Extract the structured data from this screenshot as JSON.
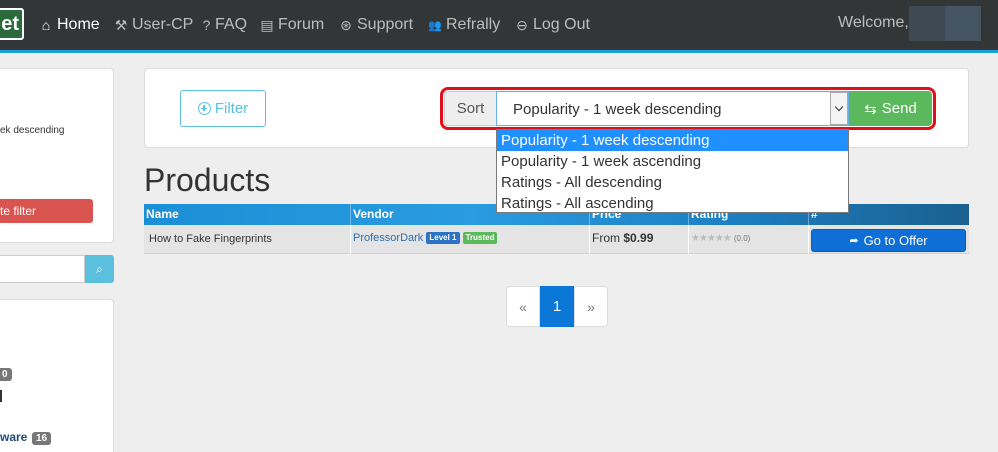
{
  "navbar": {
    "brand": "et",
    "items": [
      {
        "label": "Home",
        "icon": "home-icon",
        "glyph": "⌂",
        "active": true
      },
      {
        "label": "User-CP",
        "icon": "tools-icon",
        "glyph": "⚒"
      },
      {
        "label": "FAQ",
        "icon": "question-icon",
        "glyph": "?"
      },
      {
        "label": "Forum",
        "icon": "forum-icon",
        "glyph": "▤"
      },
      {
        "label": "Support",
        "icon": "lifebuoy-icon",
        "glyph": "⊛"
      },
      {
        "label": "Refrally",
        "icon": "users-icon",
        "glyph": "👥"
      },
      {
        "label": "Log Out",
        "icon": "logout-icon",
        "glyph": "⊖"
      }
    ],
    "welcome": "Welcome,"
  },
  "sidebar": {
    "sort_text": "ek descending",
    "filter_button": "te filter",
    "search_icon": "⌕",
    "badge_a": "0",
    "badge_b": "16",
    "category_label": "ware"
  },
  "filter": {
    "button_label": "Filter",
    "sort_label": "Sort",
    "selected": "Popularity - 1 week descending",
    "send_label": "Send",
    "send_icon": "⇆",
    "options": [
      "Popularity - 1 week descending",
      "Popularity - 1 week ascending",
      "Ratings - All descending",
      "Ratings - All ascending"
    ]
  },
  "products": {
    "title": "Products",
    "columns": [
      "Name",
      "Vendor",
      "Price",
      "Rating",
      "#"
    ],
    "rows": [
      {
        "name": "How to Fake Fingerprints",
        "vendor": "ProfessorDark",
        "level_badge": "Level 1",
        "trusted_badge": "Trusted",
        "price_prefix": "From",
        "price": "$0.99",
        "stars": "★★★★★",
        "rating_count": "(0.0)",
        "action": "Go to Offer",
        "action_icon": "➦"
      }
    ]
  },
  "pagination": {
    "prev": "«",
    "current": "1",
    "next": "»"
  },
  "colors": {
    "navbar_bg": "#333637",
    "accent_blue": "#1a9fd8",
    "send_green": "#5cb85c",
    "highlight_red": "#e0101a",
    "primary": "#0b78d7"
  }
}
